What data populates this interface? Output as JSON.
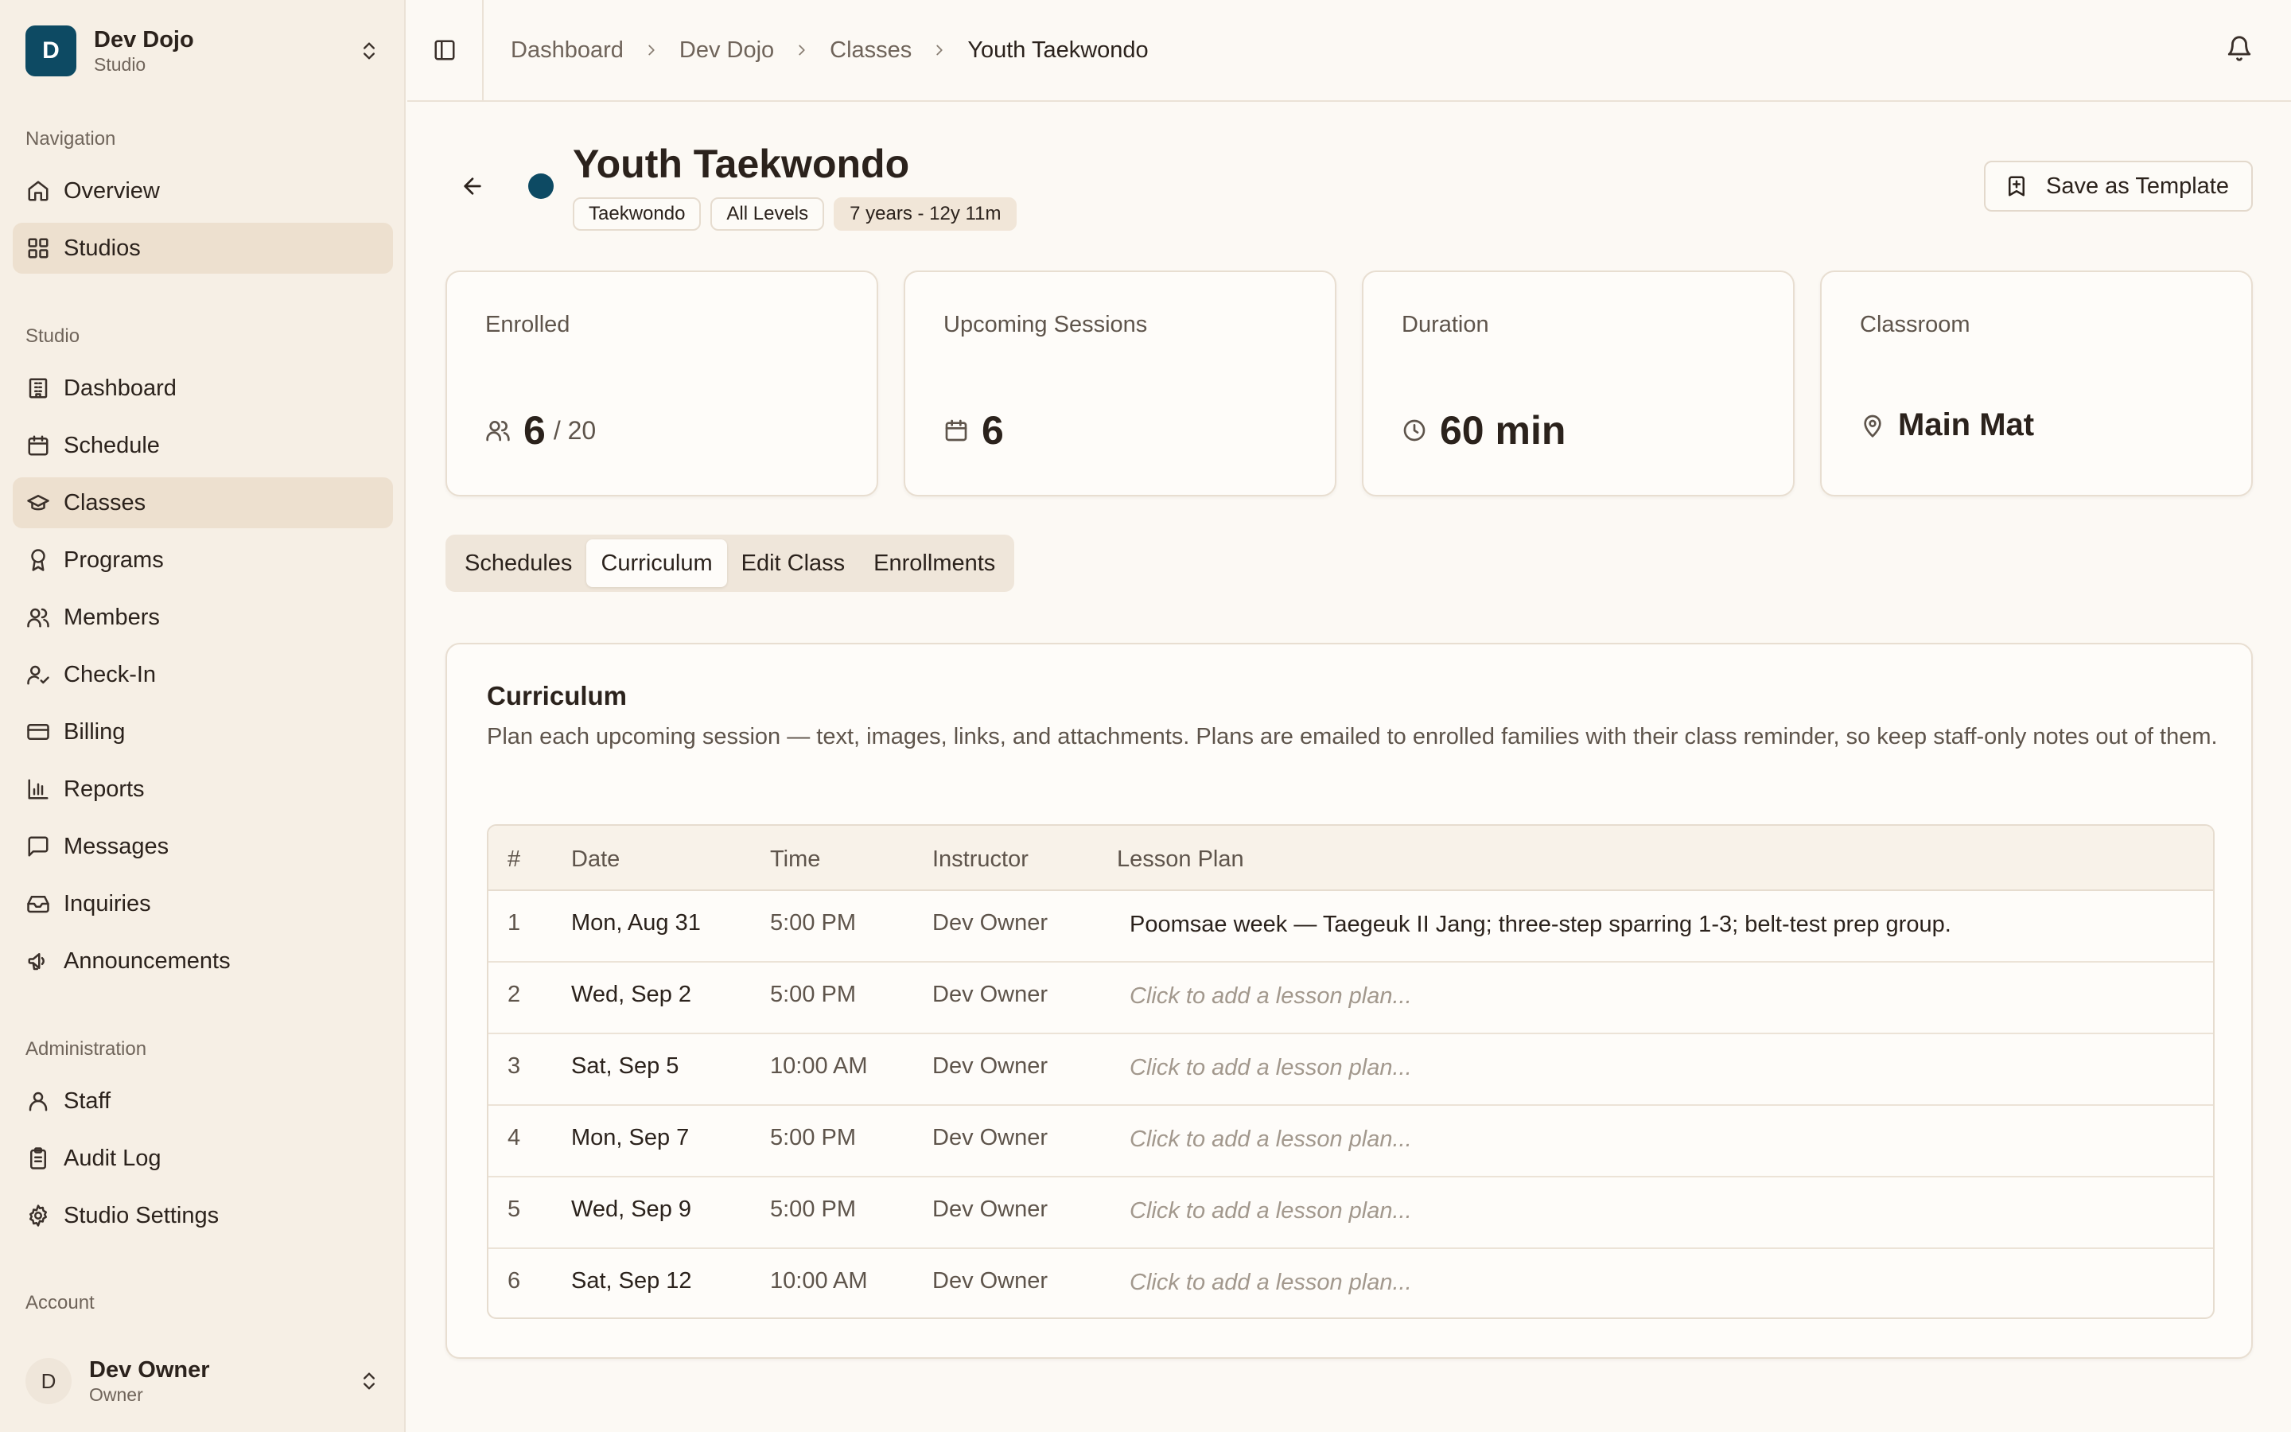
{
  "workspace": {
    "initial": "D",
    "name": "Dev Dojo",
    "subtitle": "Studio"
  },
  "nav": {
    "navigation_label": "Navigation",
    "navigation": [
      {
        "label": "Overview",
        "icon": "home-icon"
      },
      {
        "label": "Studios",
        "icon": "grid-icon",
        "active": true
      }
    ],
    "studio_label": "Studio",
    "studio": [
      {
        "label": "Dashboard",
        "icon": "building-icon"
      },
      {
        "label": "Schedule",
        "icon": "calendar-icon"
      },
      {
        "label": "Classes",
        "icon": "graduation-cap-icon",
        "active": true
      },
      {
        "label": "Programs",
        "icon": "award-icon"
      },
      {
        "label": "Members",
        "icon": "users-icon"
      },
      {
        "label": "Check-In",
        "icon": "user-check-icon"
      },
      {
        "label": "Billing",
        "icon": "credit-card-icon"
      },
      {
        "label": "Reports",
        "icon": "bar-chart-icon"
      },
      {
        "label": "Messages",
        "icon": "message-square-icon"
      },
      {
        "label": "Inquiries",
        "icon": "inbox-icon"
      },
      {
        "label": "Announcements",
        "icon": "megaphone-icon"
      }
    ],
    "admin_label": "Administration",
    "admin": [
      {
        "label": "Staff",
        "icon": "user-icon"
      },
      {
        "label": "Audit Log",
        "icon": "clipboard-icon"
      },
      {
        "label": "Studio Settings",
        "icon": "gear-icon"
      }
    ],
    "account_label": "Account"
  },
  "account": {
    "initial": "D",
    "name": "Dev Owner",
    "role": "Owner"
  },
  "breadcrumb": [
    "Dashboard",
    "Dev Dojo",
    "Classes",
    "Youth Taekwondo"
  ],
  "class": {
    "title": "Youth Taekwondo",
    "color": "#0d4a63",
    "badges": [
      "Taekwondo",
      "All Levels",
      "7 years - 12y 11m"
    ]
  },
  "actions": {
    "save_template": "Save as Template"
  },
  "stats": {
    "enrolled": {
      "label": "Enrolled",
      "value": "6",
      "capacity": "/ 20"
    },
    "sessions": {
      "label": "Upcoming Sessions",
      "value": "6"
    },
    "duration": {
      "label": "Duration",
      "value": "60 min"
    },
    "classroom": {
      "label": "Classroom",
      "value": "Main Mat"
    }
  },
  "tabs": [
    {
      "label": "Schedules"
    },
    {
      "label": "Curriculum",
      "active": true
    },
    {
      "label": "Edit Class"
    },
    {
      "label": "Enrollments"
    }
  ],
  "curriculum": {
    "title": "Curriculum",
    "description": "Plan each upcoming session — text, images, links, and attachments. Plans are emailed to enrolled families with their class reminder, so keep staff-only notes out of them.",
    "columns": [
      "#",
      "Date",
      "Time",
      "Instructor",
      "Lesson Plan"
    ],
    "placeholder": "Click to add a lesson plan...",
    "rows": [
      {
        "num": "1",
        "date": "Mon, Aug 31",
        "time": "5:00 PM",
        "instructor": "Dev Owner",
        "plan": "Poomsae week — Taegeuk II Jang; three-step sparring 1-3; belt-test prep group."
      },
      {
        "num": "2",
        "date": "Wed, Sep 2",
        "time": "5:00 PM",
        "instructor": "Dev Owner",
        "plan": ""
      },
      {
        "num": "3",
        "date": "Sat, Sep 5",
        "time": "10:00 AM",
        "instructor": "Dev Owner",
        "plan": ""
      },
      {
        "num": "4",
        "date": "Mon, Sep 7",
        "time": "5:00 PM",
        "instructor": "Dev Owner",
        "plan": ""
      },
      {
        "num": "5",
        "date": "Wed, Sep 9",
        "time": "5:00 PM",
        "instructor": "Dev Owner",
        "plan": ""
      },
      {
        "num": "6",
        "date": "Sat, Sep 12",
        "time": "10:00 AM",
        "instructor": "Dev Owner",
        "plan": ""
      }
    ]
  }
}
